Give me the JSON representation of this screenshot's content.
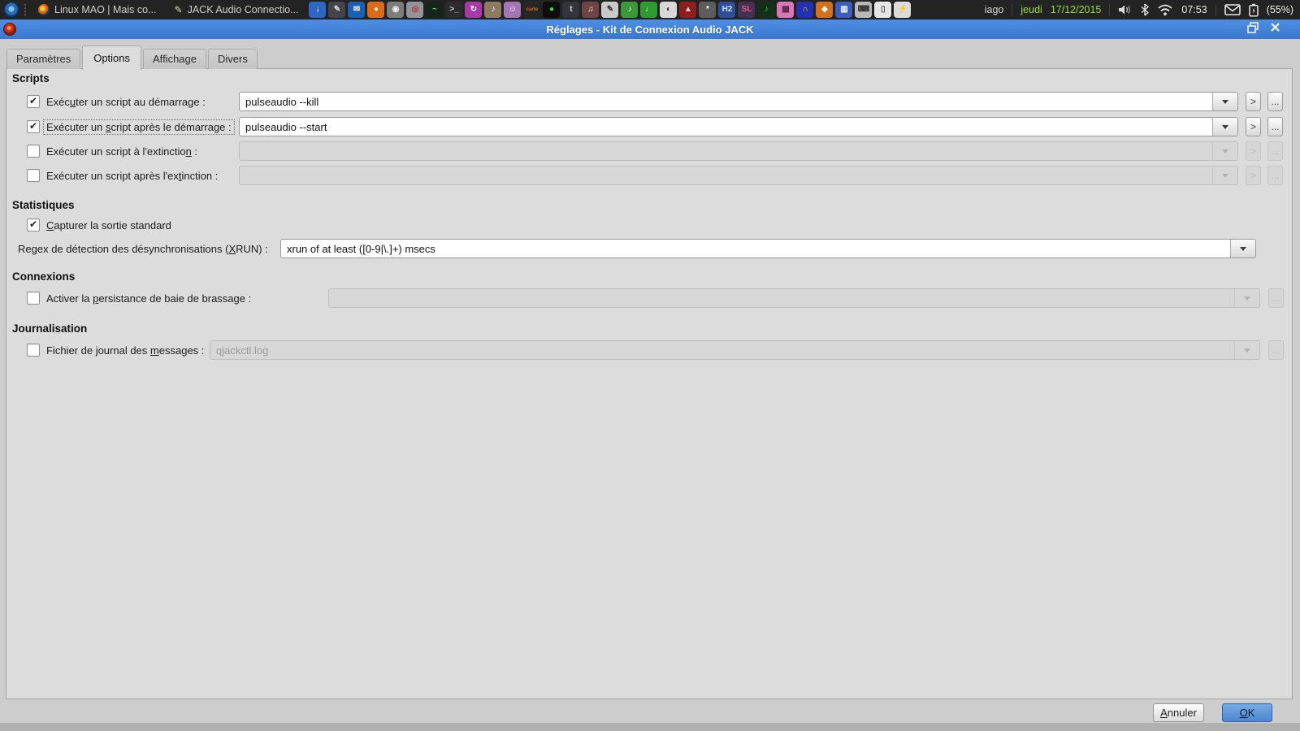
{
  "panel": {
    "windows": [
      {
        "label": "Linux MAO | Mais co...",
        "icon": "firefox-icon"
      },
      {
        "label": "JACK Audio Connectio...",
        "icon": "pencil-icon"
      }
    ],
    "launchers": [
      {
        "name": "download-icon",
        "bg": "#2f66c4",
        "fg": "#ffffff",
        "glyph": "↓"
      },
      {
        "name": "text-editor-icon",
        "bg": "#44444c",
        "fg": "#dddddd",
        "glyph": "✎"
      },
      {
        "name": "thunderbird-icon",
        "bg": "#1b5fb4",
        "fg": "#ffffff",
        "glyph": "✉"
      },
      {
        "name": "firefox-icon",
        "bg": "#d96b1a",
        "fg": "#ffe9c9",
        "glyph": "●"
      },
      {
        "name": "camera-icon",
        "bg": "#7d7d7d",
        "fg": "#eeeeee",
        "glyph": "◉"
      },
      {
        "name": "disc-burner-icon",
        "bg": "#93939b",
        "fg": "#c03030",
        "glyph": "◎"
      },
      {
        "name": "oscilloscope-icon",
        "bg": "#16241a",
        "fg": "#4be04b",
        "glyph": "~"
      },
      {
        "name": "terminal-icon",
        "bg": "#2b2b2b",
        "fg": "#cfcfcf",
        "glyph": ">_"
      },
      {
        "name": "sync-icon",
        "bg": "#a83aa8",
        "fg": "#ffffff",
        "glyph": "↻"
      },
      {
        "name": "mixer-icon",
        "bg": "#8d7a60",
        "fg": "#ffffff",
        "glyph": "♪"
      },
      {
        "name": "comic-icon",
        "bg": "#a574b5",
        "fg": "#ffffff",
        "glyph": "☺"
      },
      {
        "name": "carte-icon",
        "bg": "#262626",
        "fg": "#e06a10",
        "glyph": "carte"
      },
      {
        "name": "record-led-icon",
        "bg": "#0d0d0d",
        "fg": "#35e035",
        "glyph": "●"
      },
      {
        "name": "guitarix-icon",
        "bg": "#34343c",
        "fg": "#dddddd",
        "glyph": "t"
      },
      {
        "name": "drums-icon",
        "bg": "#6e4444",
        "fg": "#ffeedd",
        "glyph": "♫"
      },
      {
        "name": "pen-icon",
        "bg": "#c9c9c9",
        "fg": "#333333",
        "glyph": "✎"
      },
      {
        "name": "score-icon",
        "bg": "#3a9a3a",
        "fg": "#ffffff",
        "glyph": "♪"
      },
      {
        "name": "mic-plug-icon",
        "bg": "#2f9a2f",
        "fg": "#eaffea",
        "glyph": "♩"
      },
      {
        "name": "gauge-icon",
        "bg": "#d8d8d8",
        "fg": "#333333",
        "glyph": "◐"
      },
      {
        "name": "ardour-icon",
        "bg": "#8c1f1f",
        "fg": "#f3caca",
        "glyph": "▲"
      },
      {
        "name": "sampler-icon",
        "bg": "#5c5c5c",
        "fg": "#ffffff",
        "glyph": "*"
      },
      {
        "name": "hydrogen-icon",
        "bg": "#2c4f96",
        "fg": "#cfe0ff",
        "glyph": "H2"
      },
      {
        "name": "sooperlooper-icon",
        "bg": "#463054",
        "fg": "#e05a8a",
        "glyph": "SL"
      },
      {
        "name": "note-circle-icon",
        "bg": "#12301a",
        "fg": "#3ad03a",
        "glyph": "♪"
      },
      {
        "name": "drum-machine-icon",
        "bg": "#d678b8",
        "fg": "#5a2048",
        "glyph": "▦"
      },
      {
        "name": "headphones-icon",
        "bg": "#2330b0",
        "fg": "#ffd83a",
        "glyph": "∩"
      },
      {
        "name": "droplet-icon",
        "bg": "#d07020",
        "fg": "#fff4e0",
        "glyph": "◆"
      },
      {
        "name": "virtual-keyboard-icon",
        "bg": "#3c5cc0",
        "fg": "#ffffff",
        "glyph": "▥"
      },
      {
        "name": "keyboard-layout-icon",
        "bg": "#b9b9b9",
        "fg": "#333333",
        "glyph": "⌨"
      },
      {
        "name": "mouse-icon",
        "bg": "#e6e6e6",
        "fg": "#555555",
        "glyph": "▯"
      },
      {
        "name": "battery-charge-icon",
        "bg": "#dcdcdc",
        "fg": "#333333",
        "glyph": "⚡"
      }
    ],
    "username": "iago",
    "day": "jeudi",
    "date": "17/12/2015",
    "time": "07:53",
    "battery_percent": "(55%)",
    "colors": {
      "date_green": "#9ade37",
      "panel_bg": "#232323"
    }
  },
  "titlebar": {
    "title": "Réglages - Kit de Connexion Audio JACK",
    "accent": "#3d7fd6"
  },
  "dialog": {
    "tabs": [
      {
        "label": "Paramètres"
      },
      {
        "label": "Options"
      },
      {
        "label": "Affichage"
      },
      {
        "label": "Divers"
      }
    ],
    "active_tab": "Options",
    "scripts": {
      "heading": "Scripts",
      "rows": [
        {
          "label": "Exéc&uter un script au démarrage :",
          "checked": true,
          "enabled": true,
          "value": "pulseaudio --kill"
        },
        {
          "label": "Exécuter un &script après le démarrage :",
          "checked": true,
          "enabled": true,
          "value": "pulseaudio --start",
          "focused": true
        },
        {
          "label": "Exécuter un script à l'extinctio&n :",
          "checked": false,
          "enabled": false,
          "value": ""
        },
        {
          "label": "Exécuter un script après l'ex&tinction :",
          "checked": false,
          "enabled": false,
          "value": ""
        }
      ],
      "run_button": ">",
      "browse_button": "..."
    },
    "statistics": {
      "heading": "Statistiques",
      "capture_label": "&Capturer la sortie standard",
      "capture_checked": true,
      "regex_label": "Regex de détection des désynchronisations (&XRUN) :",
      "regex_value": "xrun of at least ([0-9|\\.]+) msecs"
    },
    "connections": {
      "heading": "Connexions",
      "label": "Activer la &persistance de baie de brassage :",
      "checked": false,
      "value": "",
      "browse_button": "..."
    },
    "logging": {
      "heading": "Journalisation",
      "label": "Fichier de journal des &messages :",
      "checked": false,
      "placeholder": "qjackctl.log",
      "browse_button": "..."
    },
    "buttons": {
      "cancel": "&Annuler",
      "ok": "&OK"
    }
  }
}
